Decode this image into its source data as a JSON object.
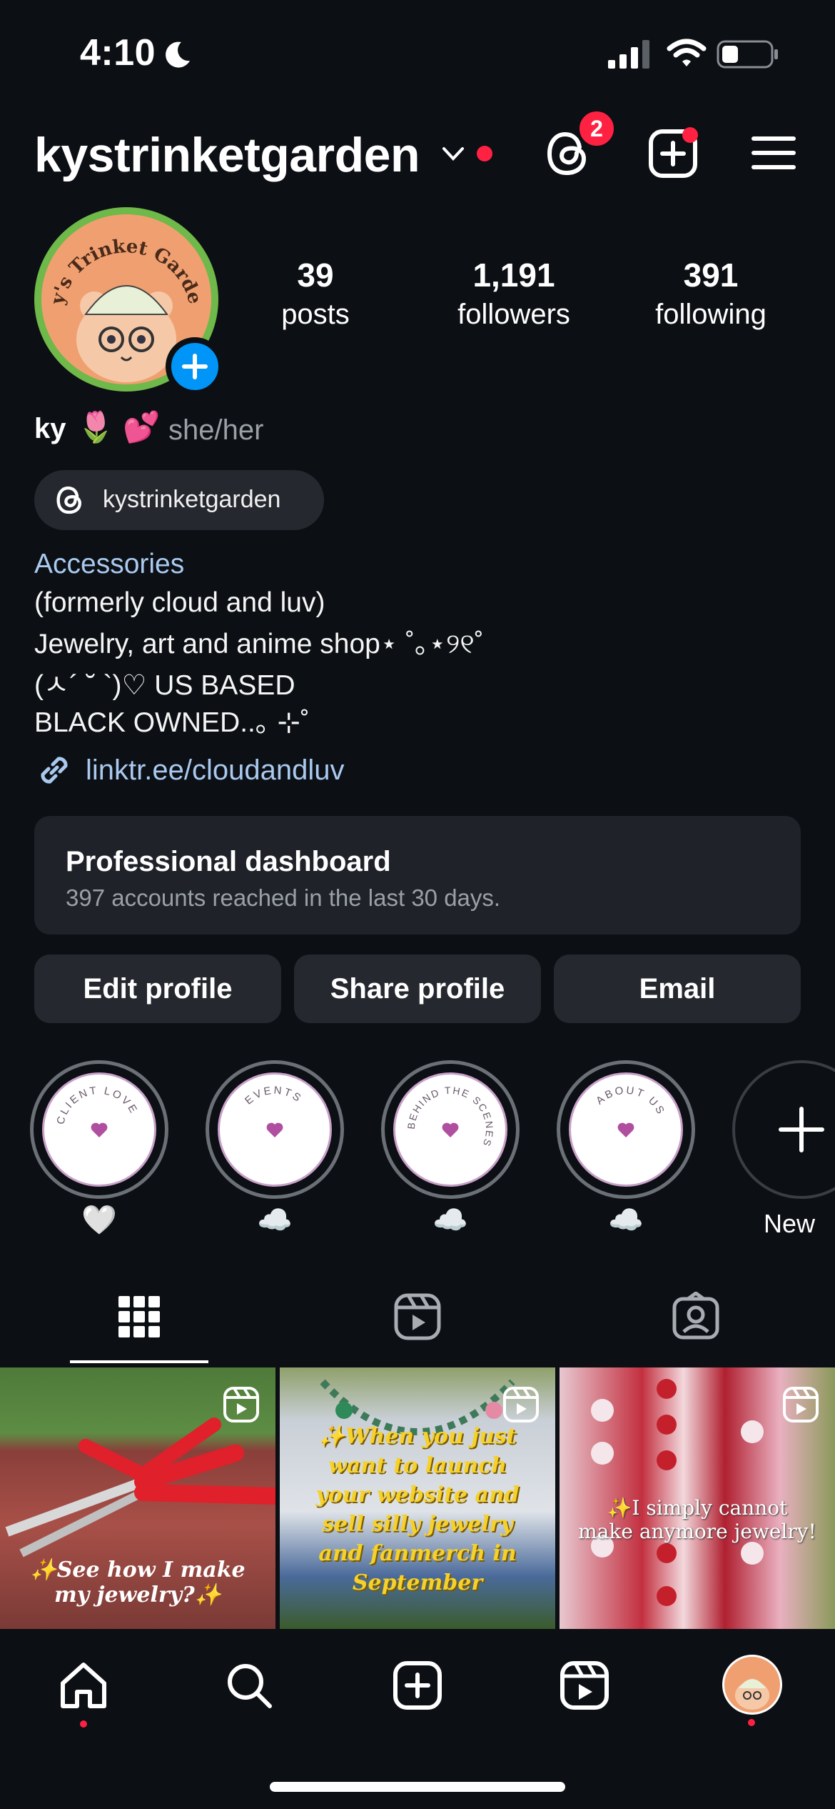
{
  "status_bar": {
    "time": "4:10"
  },
  "header": {
    "username": "kystrinketgarden",
    "threads_badge_count": "2"
  },
  "profile": {
    "avatar_text": "ky's Trinket Garden",
    "stats": [
      {
        "number": "39",
        "label": "posts"
      },
      {
        "number": "1,191",
        "label": "followers"
      },
      {
        "number": "391",
        "label": "following"
      }
    ],
    "name": "ky",
    "name_emoji": "🌷 💕",
    "pronouns": "she/her",
    "threads_handle": "kystrinketgarden",
    "category": "Accessories",
    "bio_lines": [
      "(formerly cloud and luv)",
      "Jewelry, art and anime shop⋆ ˚｡⋆୨୧˚",
      "(ㅅ´ ˘ `)♡ US BASED",
      "BLACK OWNED..｡ ⊹˚"
    ],
    "link": "linktr.ee/cloudandluv"
  },
  "dashboard": {
    "title": "Professional dashboard",
    "subtitle": "397 accounts reached in the last 30 days."
  },
  "actions": {
    "edit": "Edit profile",
    "share": "Share profile",
    "email": "Email"
  },
  "highlights": [
    {
      "ring_text": "CLIENT LOVE",
      "caption": "🤍"
    },
    {
      "ring_text": "EVENTS",
      "caption": "☁️"
    },
    {
      "ring_text": "BEHIND THE SCENES",
      "caption": "☁️"
    },
    {
      "ring_text": "ABOUT US",
      "caption": "☁️"
    }
  ],
  "new_highlight_label": "New",
  "posts": [
    {
      "caption": "✨See how I make my jewelry?✨"
    },
    {
      "caption": "✨When you just want to launch your website and sell silly jewelry and fanmerch in September"
    },
    {
      "caption": "✨I simply cannot make anymore jewelry!"
    }
  ],
  "colors": {
    "background": "#0c0f14",
    "accent_blue": "#0095f6",
    "notification_red": "#ff2142",
    "link": "#a9c9ef"
  }
}
